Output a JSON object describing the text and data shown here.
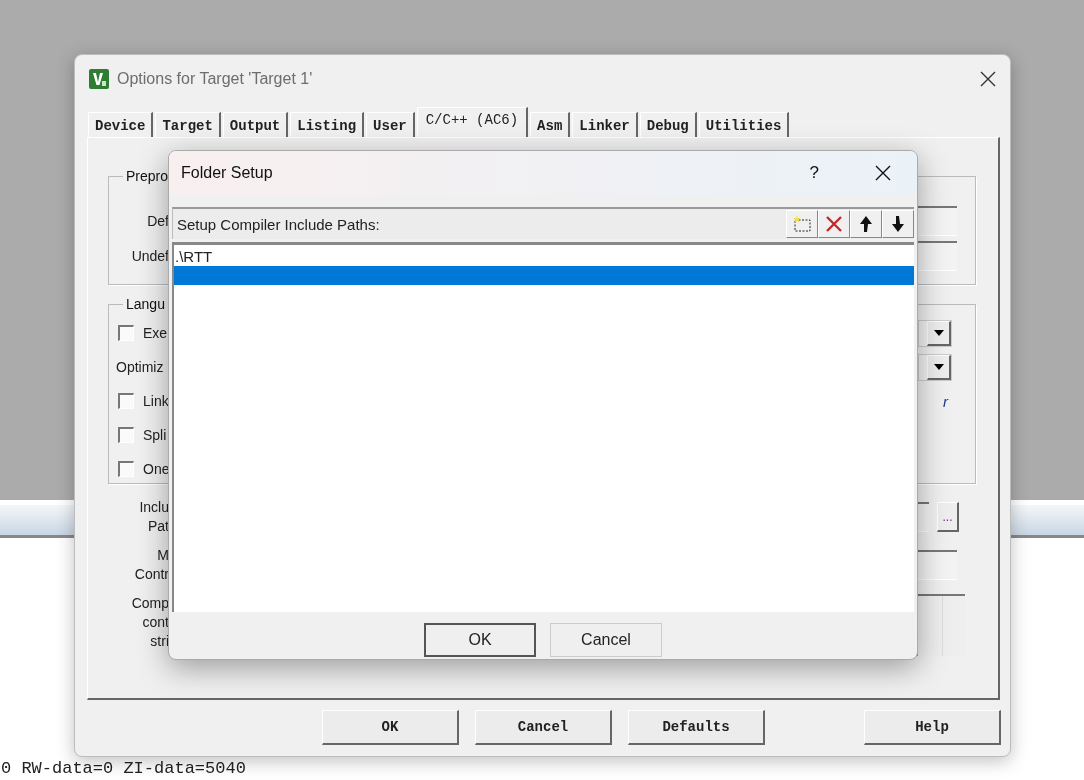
{
  "background": {
    "output_line": "0 RW-data=0 ZI-data=5040"
  },
  "options_window": {
    "title": "Options for Target 'Target 1'",
    "tabs": [
      {
        "label": "Device",
        "selected": false
      },
      {
        "label": "Target",
        "selected": false
      },
      {
        "label": "Output",
        "selected": false
      },
      {
        "label": "Listing",
        "selected": false
      },
      {
        "label": "User",
        "selected": false
      },
      {
        "label": "C/C++ (AC6)",
        "selected": true
      },
      {
        "label": "Asm",
        "selected": false
      },
      {
        "label": "Linker",
        "selected": false
      },
      {
        "label": "Debug",
        "selected": false
      },
      {
        "label": "Utilities",
        "selected": false
      }
    ],
    "preprocessor_group": {
      "legend": "Prepro",
      "rows": [
        {
          "label": "Def"
        },
        {
          "label": "Undef"
        }
      ]
    },
    "language_group": {
      "legend": "Langu",
      "rows": [
        {
          "kind": "checkbox",
          "label": "Exe",
          "checked": false,
          "has_dropdown": true
        },
        {
          "kind": "label",
          "label": "Optimiz",
          "has_dropdown": true
        },
        {
          "kind": "checkbox",
          "label": "Link",
          "checked": false,
          "trailing_text": "r"
        },
        {
          "kind": "checkbox",
          "label": "Spli",
          "checked": false
        },
        {
          "kind": "checkbox",
          "label": "One",
          "checked": false
        }
      ]
    },
    "include_paths": {
      "label_lines": [
        "Inclu",
        "Pat"
      ],
      "browse_button": "..."
    },
    "misc_controls": {
      "label_lines": [
        "M",
        "Contr"
      ]
    },
    "compiler_string": {
      "label_lines": [
        "Comp",
        "cont",
        "stri"
      ]
    },
    "buttons": [
      "OK",
      "Cancel",
      "Defaults",
      "Help"
    ]
  },
  "folder_setup": {
    "title": "Folder Setup",
    "help": "?",
    "toolbar_label": "Setup Compiler Include Paths:",
    "paths": [
      {
        "kind": "path",
        "text": ".\\RTT",
        "selected": false
      },
      {
        "kind": "new-entry",
        "selected": true
      }
    ],
    "buttons": [
      "OK",
      "Cancel"
    ]
  }
}
